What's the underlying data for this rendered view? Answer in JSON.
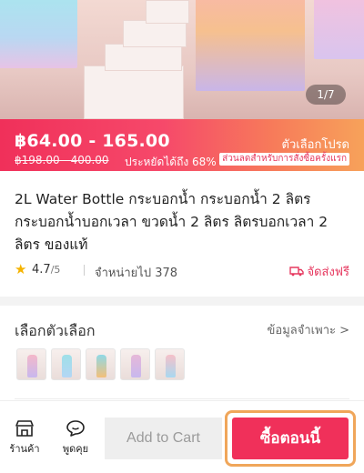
{
  "hero": {
    "image_counter": "1/7"
  },
  "price": {
    "range": "฿64.00 - 165.00",
    "original_range": "฿198.00 - 400.00",
    "savings": "ประหยัดได้ถึง 68%",
    "promo_title": "ตัวเลือกโปรด",
    "promo_subtitle": "ส่วนลดสำหรับการสั่งซื้อครั้งแรก"
  },
  "product": {
    "title": "2L Water Bottle กระบอกน้ำ กระบอกน้ำ 2 ลิตร กระบอกน้ำบอกเวลา ขวดน้ำ 2 ลิตร ลิตรบอกเวลา 2 ลิตร ของแท้",
    "rating": "4.7",
    "rating_max": "/5",
    "sold": "จำหน่ายไป 378",
    "free_shipping": "จัดส่งฟรี"
  },
  "options": {
    "label": "เลือกตัวเลือก",
    "spec_link": "ข้อมูลจำเพาะ >",
    "thumbnails": [
      {
        "top": "#f4b8c9",
        "bottom": "#c8b8ee"
      },
      {
        "top": "#9fe0e8",
        "bottom": "#b4d6f4"
      },
      {
        "top": "#8fd9e6",
        "bottom": "#f3c07a"
      },
      {
        "top": "#e6b8d8",
        "bottom": "#c8b8ee"
      },
      {
        "top": "#f6c0c8",
        "bottom": "#a8d8f0"
      }
    ]
  },
  "bottom_bar": {
    "shop_label": "ร้านค้า",
    "chat_label": "พูดคุย",
    "add_to_cart": "Add to Cart",
    "buy_now": "ซื้อตอนนี้"
  },
  "colors": {
    "accent": "#f0305a",
    "highlight_border": "#f0a65a"
  }
}
